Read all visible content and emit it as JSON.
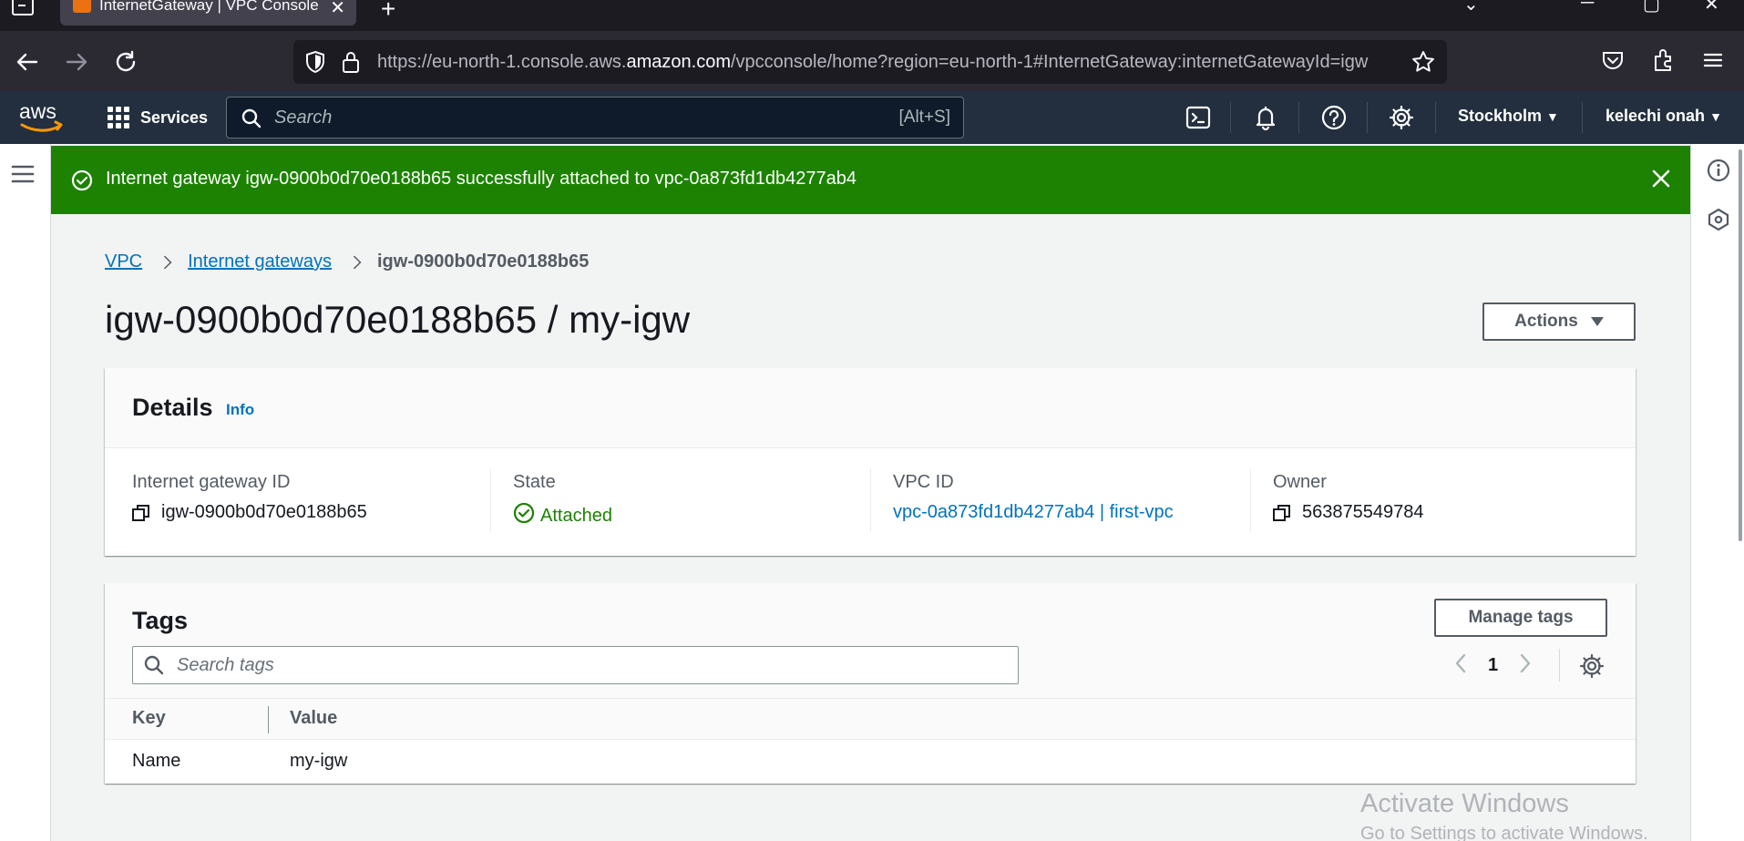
{
  "browser": {
    "tab_title": "InternetGateway | VPC Console",
    "url_prefix": "https://eu-north-1.console.aws.",
    "url_domain": "amazon.com",
    "url_suffix": "/vpcconsole/home?region=eu-north-1#InternetGateway:internetGatewayId=igw"
  },
  "aws_nav": {
    "logo": "aws",
    "services_label": "Services",
    "search_placeholder": "Search",
    "search_shortcut": "[Alt+S]",
    "region": "Stockholm",
    "user": "kelechi onah"
  },
  "flash": {
    "message": "Internet gateway igw-0900b0d70e0188b65 successfully attached to vpc-0a873fd1db4277ab4",
    "type": "success",
    "color": "#1d8102"
  },
  "breadcrumb": {
    "items": [
      "VPC",
      "Internet gateways"
    ],
    "current": "igw-0900b0d70e0188b65"
  },
  "page": {
    "title": "igw-0900b0d70e0188b65 / my-igw",
    "actions_label": "Actions"
  },
  "details": {
    "title": "Details",
    "info_label": "Info",
    "fields": [
      {
        "label": "Internet gateway ID",
        "value": "igw-0900b0d70e0188b65"
      },
      {
        "label": "State",
        "value": "Attached"
      },
      {
        "label": "VPC ID",
        "value": "vpc-0a873fd1db4277ab4 | first-vpc"
      },
      {
        "label": "Owner",
        "value": "563875549784"
      }
    ]
  },
  "tags": {
    "title": "Tags",
    "manage_label": "Manage tags",
    "search_placeholder": "Search tags",
    "page": "1",
    "columns": [
      "Key",
      "Value"
    ],
    "rows": [
      {
        "key": "Name",
        "value": "my-igw"
      }
    ]
  },
  "watermark": {
    "line1": "Activate Windows",
    "line2": "Go to Settings to activate Windows."
  }
}
